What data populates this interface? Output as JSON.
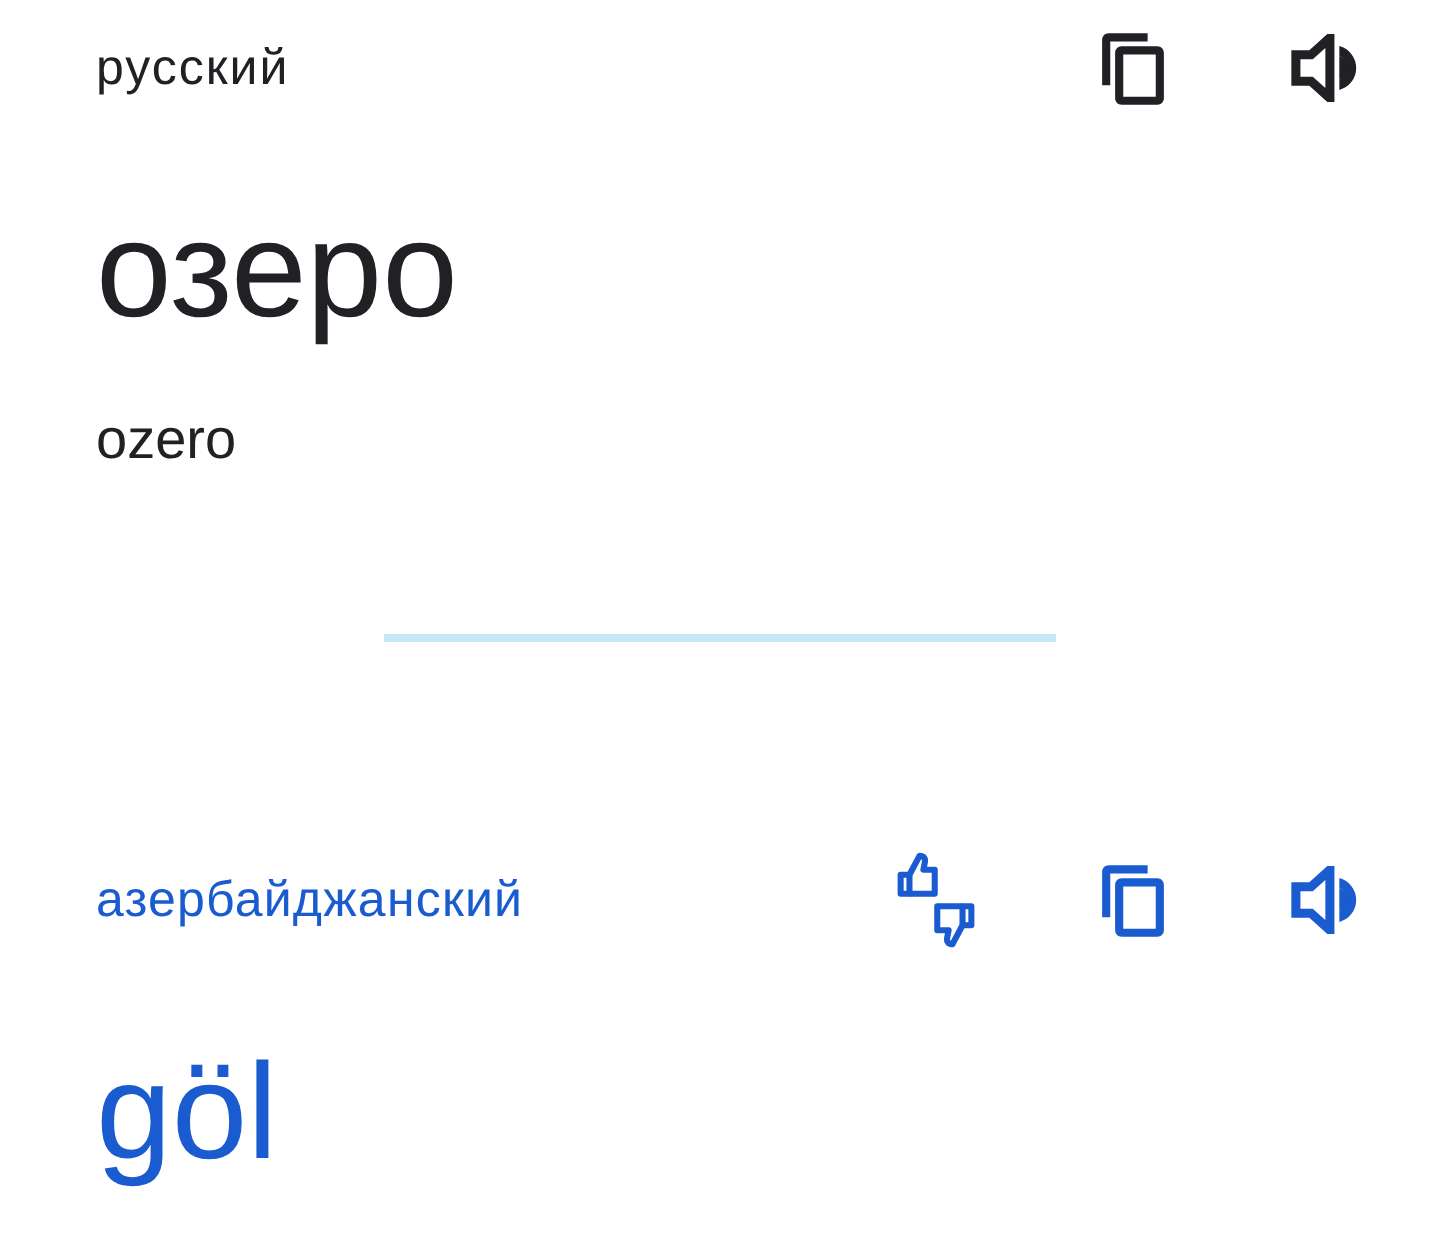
{
  "source": {
    "language": "русский",
    "text": "озеро",
    "transliteration": "ozero"
  },
  "target": {
    "language": "азербайджанский",
    "text": "göl"
  }
}
